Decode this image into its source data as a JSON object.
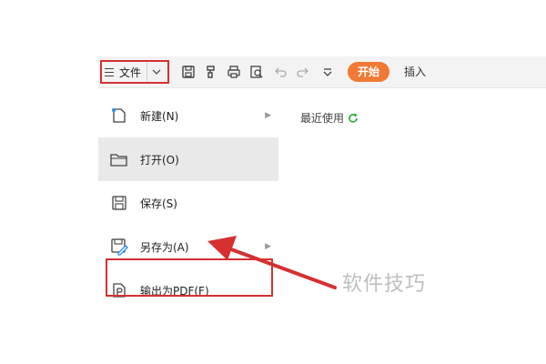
{
  "toolbar": {
    "file_label": "文件",
    "start_label": "开始",
    "insert_label": "插入"
  },
  "menu": {
    "items": [
      {
        "label": "新建(N)",
        "icon": "new-file-icon"
      },
      {
        "label": "打开(O)",
        "icon": "folder-icon"
      },
      {
        "label": "保存(S)",
        "icon": "save-icon"
      },
      {
        "label": "另存为(A)",
        "icon": "save-as-icon"
      },
      {
        "label": "输出为PDF(F)",
        "icon": "pdf-export-icon"
      }
    ]
  },
  "recent": {
    "label": "最近使用"
  },
  "watermark": "软件技巧",
  "colors": {
    "accent": "#f07a35",
    "highlight_border": "#d63030",
    "refresh_icon": "#3fae4d"
  }
}
